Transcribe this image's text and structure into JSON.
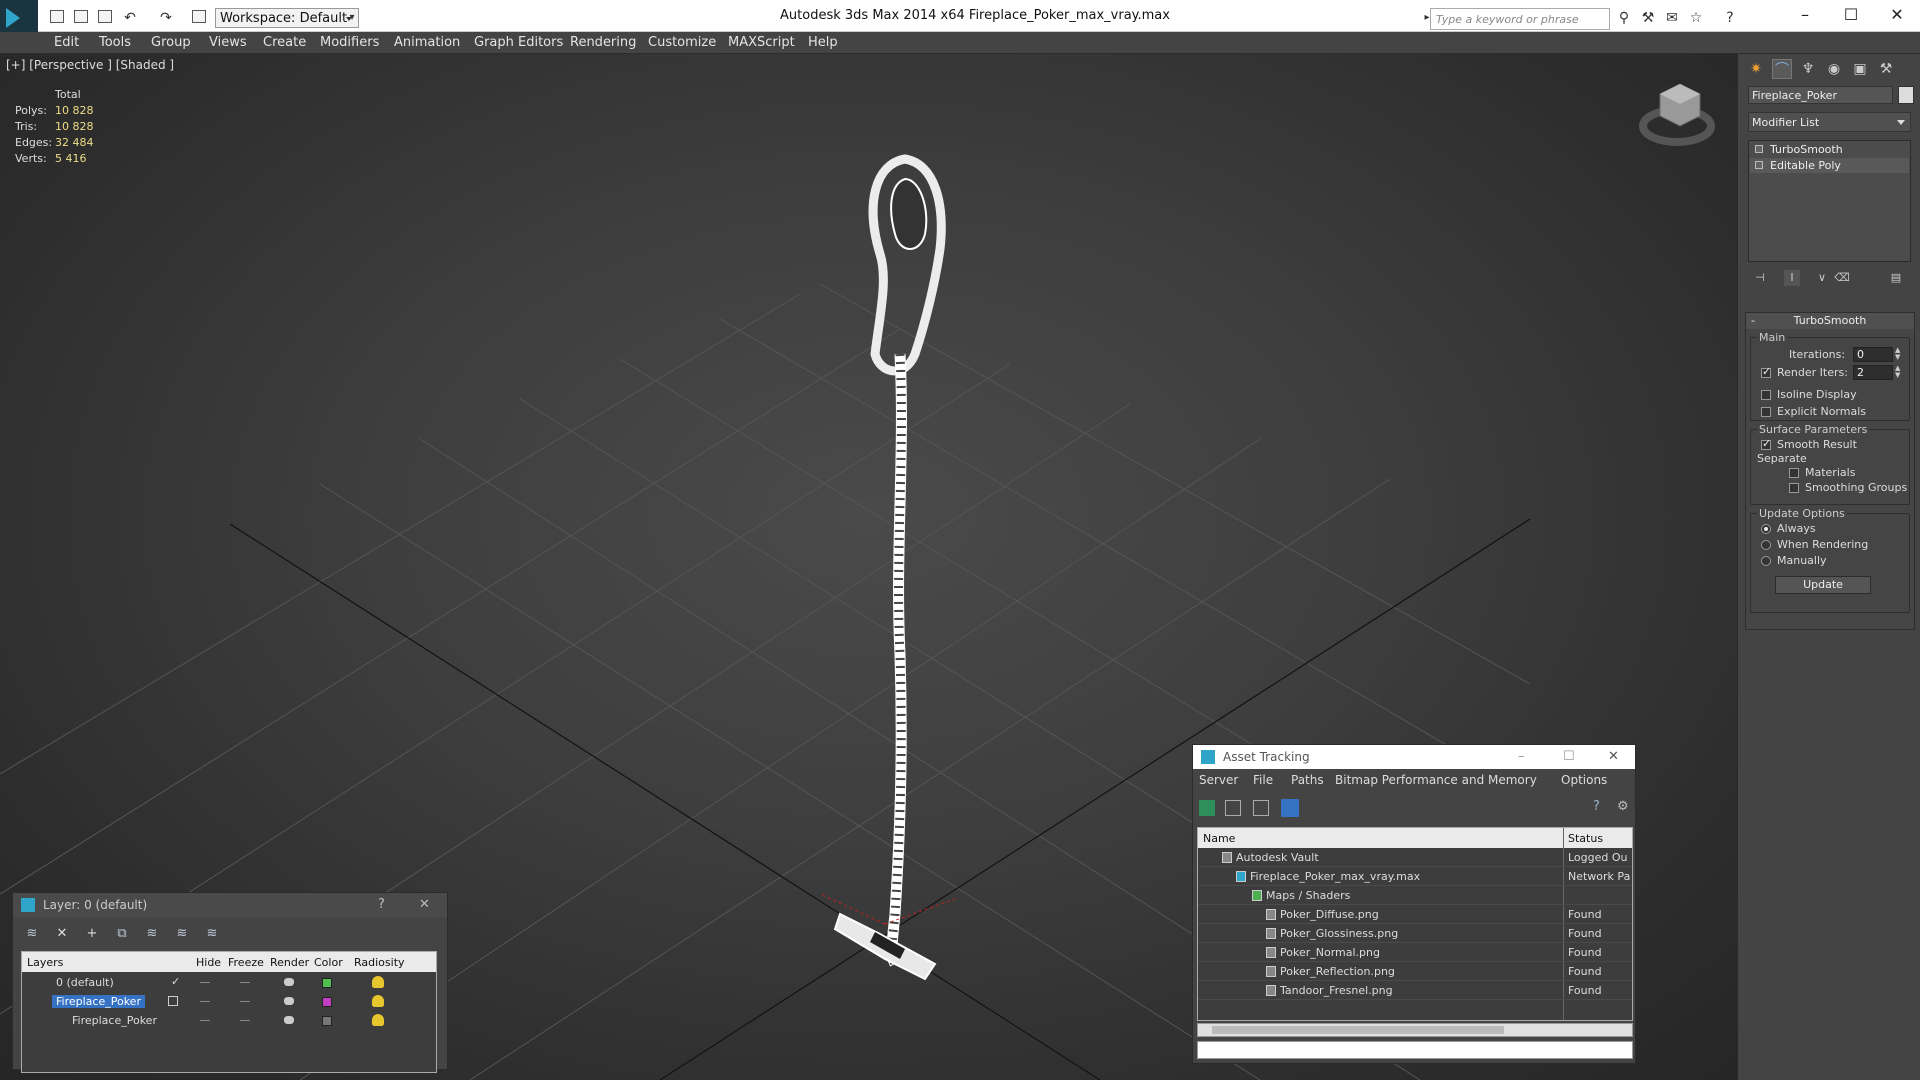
{
  "window": {
    "title": "Autodesk 3ds Max  2014 x64     Fireplace_Poker_max_vray.max",
    "workspace": "Workspace: Default",
    "search_placeholder": "Type a keyword or phrase"
  },
  "menubar": [
    "Edit",
    "Tools",
    "Group",
    "Views",
    "Create",
    "Modifiers",
    "Animation",
    "Graph Editors",
    "Rendering",
    "Customize",
    "MAXScript",
    "Help"
  ],
  "viewport": {
    "label": "[+] [Perspective ] [Shaded ]",
    "stats": {
      "header": "Total",
      "rows": [
        {
          "label": "Polys:",
          "value": "10 828"
        },
        {
          "label": "Tris:",
          "value": "10 828"
        },
        {
          "label": "Edges:",
          "value": "32 484"
        },
        {
          "label": "Verts:",
          "value": "5 416"
        }
      ]
    }
  },
  "command_panel": {
    "object_name": "Fireplace_Poker",
    "modifier_list": "Modifier List",
    "stack": [
      "TurboSmooth",
      "Editable Poly"
    ],
    "rollout": {
      "title": "TurboSmooth",
      "main_group": "Main",
      "iterations_label": "Iterations:",
      "iterations_value": "0",
      "render_iters_label": "Render Iters:",
      "render_iters_value": "2",
      "isoline": "Isoline Display",
      "explicit_normals": "Explicit Normals",
      "surface_group": "Surface Parameters",
      "smooth_result": "Smooth Result",
      "separate": "Separate",
      "materials": "Materials",
      "smoothing_groups": "Smoothing Groups",
      "update_group": "Update Options",
      "always": "Always",
      "when_rendering": "When Rendering",
      "manually": "Manually",
      "update_button": "Update"
    }
  },
  "layer_panel": {
    "title": "Layer: 0 (default)",
    "help": "?",
    "columns": [
      "Layers",
      "Hide",
      "Freeze",
      "Render",
      "Color",
      "Radiosity"
    ],
    "rows": [
      {
        "name": "0 (default)",
        "color": "#4fbf4f"
      },
      {
        "name": "Fireplace_Poker",
        "color": "#c040c0"
      },
      {
        "name": "Fireplace_Poker",
        "color": "#777777"
      }
    ]
  },
  "asset_panel": {
    "title": "Asset Tracking",
    "menu": [
      "Server",
      "File",
      "Paths",
      "Bitmap Performance and Memory",
      "Options"
    ],
    "columns": [
      "Name",
      "Status"
    ],
    "rows": [
      {
        "name": "Autodesk Vault",
        "status": "Logged Ou"
      },
      {
        "name": "Fireplace_Poker_max_vray.max",
        "status": "Network Pa"
      },
      {
        "name": "Maps / Shaders",
        "status": ""
      },
      {
        "name": "Poker_Diffuse.png",
        "status": "Found"
      },
      {
        "name": "Poker_Glossiness.png",
        "status": "Found"
      },
      {
        "name": "Poker_Normal.png",
        "status": "Found"
      },
      {
        "name": "Poker_Reflection.png",
        "status": "Found"
      },
      {
        "name": "Tandoor_Fresnel.png",
        "status": "Found"
      }
    ]
  }
}
